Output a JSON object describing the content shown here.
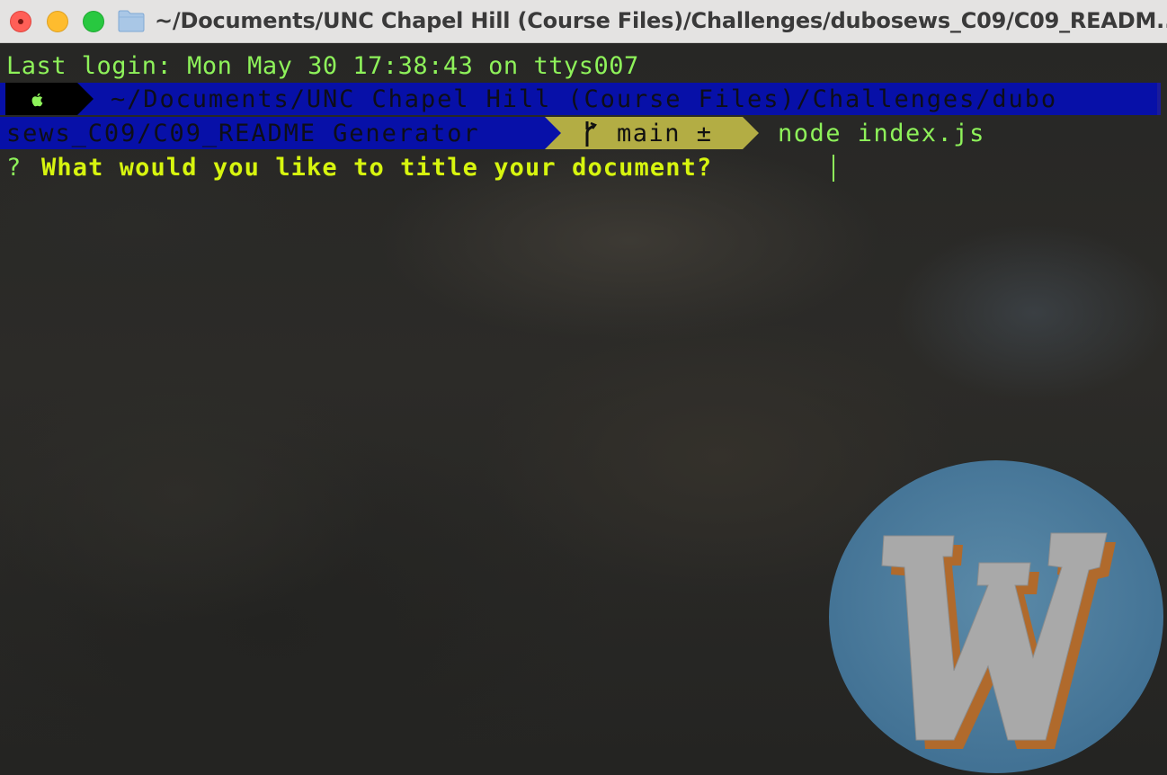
{
  "window": {
    "title": "~/Documents/UNC Chapel Hill (Course Files)/Challenges/dubosews_C09/C09_READM...",
    "folder_icon": "folder-icon"
  },
  "terminal": {
    "last_login": "Last login: Mon May 30 17:38:43 on ttys007",
    "prompt": {
      "apple_icon": "apple-icon",
      "path_line1": "~/Documents/UNC Chapel Hill (Course Files)/Challenges/dubo",
      "path_line2": "sews_C09/C09_README Generator",
      "git_icon": "git-branch-icon",
      "git_branch": "main ±",
      "command": "node index.js"
    },
    "question_mark": "?",
    "question": "What would you like to title your document?"
  },
  "colors": {
    "prompt_green": "#8ef25a",
    "question_yellow": "#d7f50f",
    "path_blue": "#0710a8",
    "git_segment": "#b3ad44"
  },
  "overlay_logo": "w-logo-icon"
}
